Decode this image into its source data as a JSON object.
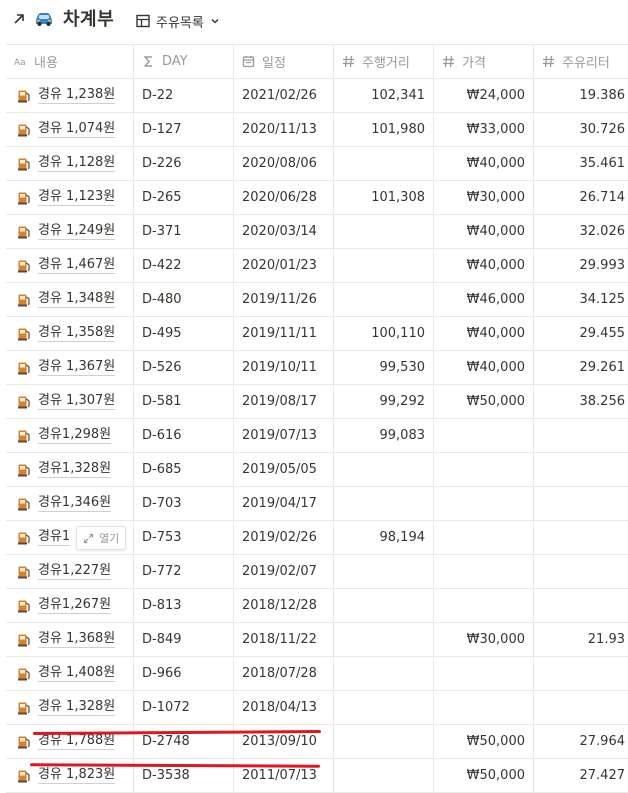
{
  "header": {
    "title": "차계부",
    "view_label": "주유목록"
  },
  "columns": [
    {
      "label": "내용",
      "icon": "text-icon"
    },
    {
      "label": "DAY",
      "icon": "sigma-icon"
    },
    {
      "label": "일정",
      "icon": "calendar-icon"
    },
    {
      "label": "주행거리",
      "icon": "hash-icon"
    },
    {
      "label": "가격",
      "icon": "hash-icon"
    },
    {
      "label": "주유리터",
      "icon": "hash-icon"
    }
  ],
  "rows": [
    {
      "name": "경유 1,238원",
      "day": "D-22",
      "date": "2021/02/26",
      "km": "102,341",
      "price": "₩24,000",
      "liter": "19.386"
    },
    {
      "name": "경유 1,074원",
      "day": "D-127",
      "date": "2020/11/13",
      "km": "101,980",
      "price": "₩33,000",
      "liter": "30.726"
    },
    {
      "name": "경유 1,128원",
      "day": "D-226",
      "date": "2020/08/06",
      "km": "",
      "price": "₩40,000",
      "liter": "35.461"
    },
    {
      "name": "경유 1,123원",
      "day": "D-265",
      "date": "2020/06/28",
      "km": "101,308",
      "price": "₩30,000",
      "liter": "26.714"
    },
    {
      "name": "경유 1,249원",
      "day": "D-371",
      "date": "2020/03/14",
      "km": "",
      "price": "₩40,000",
      "liter": "32.026"
    },
    {
      "name": "경유 1,467원",
      "day": "D-422",
      "date": "2020/01/23",
      "km": "",
      "price": "₩40,000",
      "liter": "29.993"
    },
    {
      "name": "경유 1,348원",
      "day": "D-480",
      "date": "2019/11/26",
      "km": "",
      "price": "₩46,000",
      "liter": "34.125"
    },
    {
      "name": "경유 1,358원",
      "day": "D-495",
      "date": "2019/11/11",
      "km": "100,110",
      "price": "₩40,000",
      "liter": "29.455"
    },
    {
      "name": "경유 1,367원",
      "day": "D-526",
      "date": "2019/10/11",
      "km": "99,530",
      "price": "₩40,000",
      "liter": "29.261"
    },
    {
      "name": "경유 1,307원",
      "day": "D-581",
      "date": "2019/08/17",
      "km": "99,292",
      "price": "₩50,000",
      "liter": "38.256"
    },
    {
      "name": "경유1,298원",
      "day": "D-616",
      "date": "2019/07/13",
      "km": "99,083",
      "price": "",
      "liter": ""
    },
    {
      "name": "경유1,328원",
      "day": "D-685",
      "date": "2019/05/05",
      "km": "",
      "price": "",
      "liter": ""
    },
    {
      "name": "경유1,346원",
      "day": "D-703",
      "date": "2019/04/17",
      "km": "",
      "price": "",
      "liter": ""
    },
    {
      "name": "경유1",
      "day": "D-753",
      "date": "2019/02/26",
      "km": "98,194",
      "price": "",
      "liter": "",
      "hover_label": "열기"
    },
    {
      "name": "경유1,227원",
      "day": "D-772",
      "date": "2019/02/07",
      "km": "",
      "price": "",
      "liter": ""
    },
    {
      "name": "경유1,267원",
      "day": "D-813",
      "date": "2018/12/28",
      "km": "",
      "price": "",
      "liter": ""
    },
    {
      "name": "경유 1,368원",
      "day": "D-849",
      "date": "2018/11/22",
      "km": "",
      "price": "₩30,000",
      "liter": "21.93"
    },
    {
      "name": "경유 1,408원",
      "day": "D-966",
      "date": "2018/07/28",
      "km": "",
      "price": "",
      "liter": ""
    },
    {
      "name": "경유 1,328원",
      "day": "D-1072",
      "date": "2018/04/13",
      "km": "",
      "price": "",
      "liter": ""
    },
    {
      "name": "경유 1,788원",
      "day": "D-2748",
      "date": "2013/09/10",
      "km": "",
      "price": "₩50,000",
      "liter": "27.964"
    },
    {
      "name": "경유 1,823원",
      "day": "D-3538",
      "date": "2011/07/13",
      "km": "",
      "price": "₩50,000",
      "liter": "27.427"
    }
  ],
  "colors": {
    "text": "#37352f",
    "muted": "#9b9a97",
    "border": "#e9e9e7",
    "annotation_red": "#e0161f"
  }
}
